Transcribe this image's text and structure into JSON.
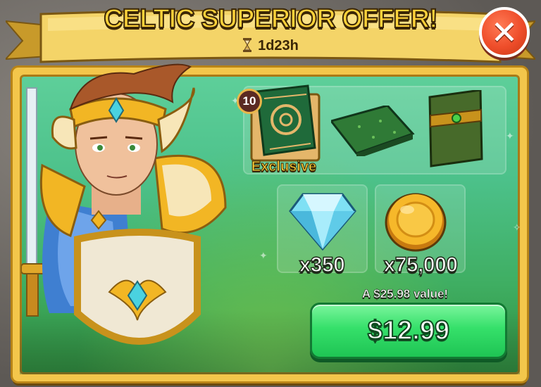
{
  "offer": {
    "title": "CELTIC SUPERIOR OFFER!",
    "timer": "1d23h",
    "close_icon": "close-icon",
    "hero_name_icon": "hero-portrait"
  },
  "items": {
    "book": {
      "level": "10",
      "tag": "Exclusive",
      "icon": "celtic-book-icon"
    },
    "ground_tile": {
      "icon": "grass-floor-tile-icon"
    },
    "wall_tile": {
      "icon": "celtic-wall-panel-icon"
    },
    "gems": {
      "quantity": "x350",
      "icon": "diamond-gem-icon"
    },
    "coins": {
      "quantity": "x75,000",
      "icon": "gold-coin-icon"
    }
  },
  "purchase": {
    "value_text": "A $25.98 value!",
    "price": "$12.99"
  },
  "colors": {
    "accent_gold": "#f3c64b",
    "buy_green": "#35e06a",
    "close_red": "#ee4d2a"
  }
}
